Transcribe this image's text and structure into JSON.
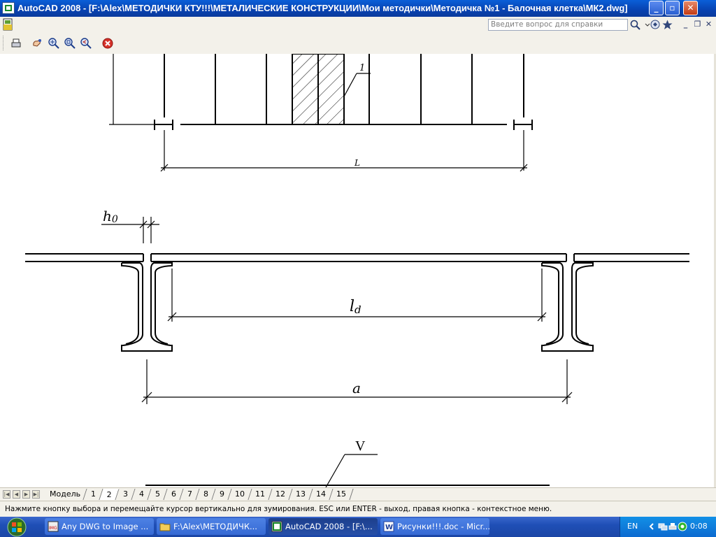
{
  "window": {
    "title": "AutoCAD 2008 - [F:\\Alex\\МЕТОДИЧКИ КТУ!!!\\МЕТАЛИЧЕСКИЕ КОНСТРУКЦИИ\\Мои методички\\Методичка №1 - Балочная клетка\\МК2.dwg]",
    "buttons": {
      "minimize": "_",
      "restore": "▫",
      "close": "✕"
    }
  },
  "menubar": {
    "help_placeholder": "Введите вопрос для справки",
    "doc_controls": {
      "minimize": "_",
      "restore": "❐",
      "close": "✕"
    }
  },
  "drawing": {
    "label_1": "1",
    "label_L": "L",
    "label_h0_main": "h",
    "label_h0_sub": "0",
    "label_ld_main": "l",
    "label_ld_sub": "d",
    "label_a": "a",
    "label_V": "V"
  },
  "layout_tabs": {
    "items": [
      "Модель",
      "1",
      "2",
      "3",
      "4",
      "5",
      "6",
      "7",
      "8",
      "9",
      "10",
      "11",
      "12",
      "13",
      "14",
      "15"
    ],
    "active_index": 2
  },
  "status": {
    "message": "Нажмите кнопку выбора и перемещайте курсор вертикально для зумирования. ESC или ENTER - выход, правая кнопка - контекстное меню."
  },
  "taskbar": {
    "tasks": [
      {
        "label": "Any DWG to Image ...",
        "active": false
      },
      {
        "label": "F:\\Alex\\МЕТОДИЧК...",
        "active": false
      },
      {
        "label": "AutoCAD 2008 - [F:\\...",
        "active": true
      },
      {
        "label": "Рисунки!!!.doc - Micr...",
        "active": false
      }
    ],
    "language": "EN",
    "time": "0:08"
  }
}
